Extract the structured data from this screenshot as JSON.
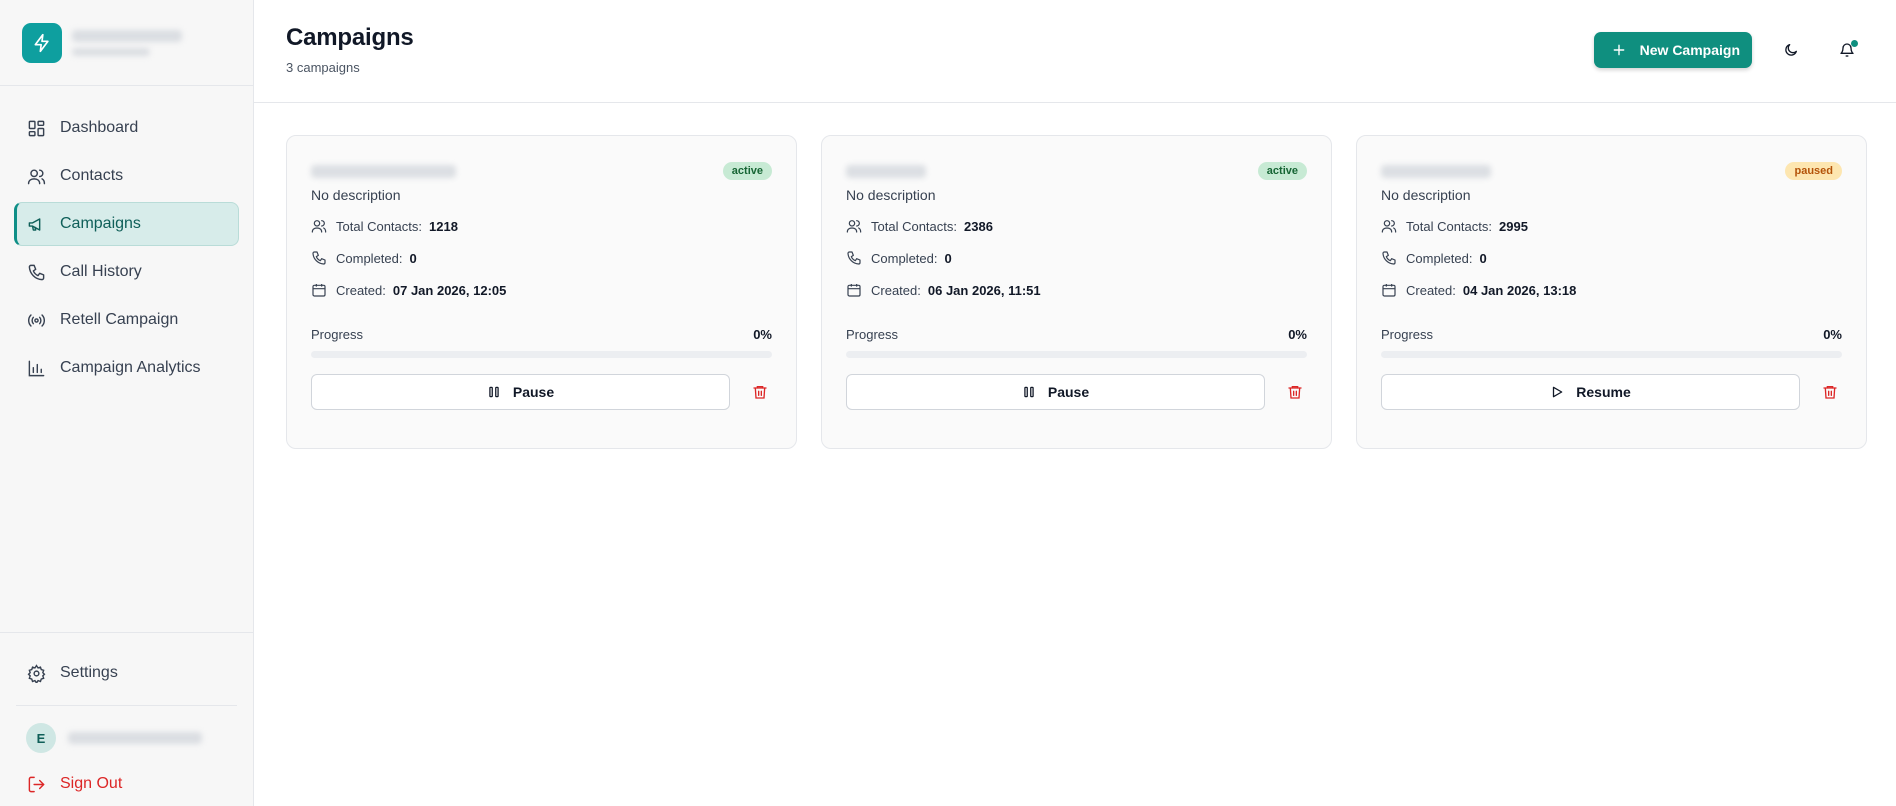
{
  "colors": {
    "accent": "#0f8f7f",
    "danger": "#dc2626",
    "badge_active": "#c7ead4",
    "badge_paused": "#fde6b0"
  },
  "sidebar": {
    "items": [
      {
        "label": "Dashboard",
        "icon": "dashboard-icon"
      },
      {
        "label": "Contacts",
        "icon": "users-icon"
      },
      {
        "label": "Campaigns",
        "icon": "megaphone-icon",
        "active": true
      },
      {
        "label": "Call History",
        "icon": "phone-icon"
      },
      {
        "label": "Retell Campaign",
        "icon": "broadcast-icon"
      },
      {
        "label": "Campaign Analytics",
        "icon": "bar-chart-icon"
      }
    ],
    "settings_label": "Settings",
    "user_initial": "E",
    "signout_label": "Sign Out"
  },
  "header": {
    "title": "Campaigns",
    "subtitle": "3 campaigns",
    "new_button_label": "New Campaign"
  },
  "campaigns": [
    {
      "status": "active",
      "description": "No description",
      "total_contacts_label": "Total Contacts:",
      "total_contacts": "1218",
      "completed_label": "Completed:",
      "completed": "0",
      "created_label": "Created:",
      "created": "07 Jan 2026, 12:05",
      "progress_label": "Progress",
      "progress_text": "0%",
      "progress_value": 0,
      "action_label": "Pause",
      "action_icon": "pause-icon"
    },
    {
      "status": "active",
      "description": "No description",
      "total_contacts_label": "Total Contacts:",
      "total_contacts": "2386",
      "completed_label": "Completed:",
      "completed": "0",
      "created_label": "Created:",
      "created": "06 Jan 2026, 11:51",
      "progress_label": "Progress",
      "progress_text": "0%",
      "progress_value": 0,
      "action_label": "Pause",
      "action_icon": "pause-icon"
    },
    {
      "status": "paused",
      "description": "No description",
      "total_contacts_label": "Total Contacts:",
      "total_contacts": "2995",
      "completed_label": "Completed:",
      "completed": "0",
      "created_label": "Created:",
      "created": "04 Jan 2026, 13:18",
      "progress_label": "Progress",
      "progress_text": "0%",
      "progress_value": 0,
      "action_label": "Resume",
      "action_icon": "play-icon"
    }
  ]
}
